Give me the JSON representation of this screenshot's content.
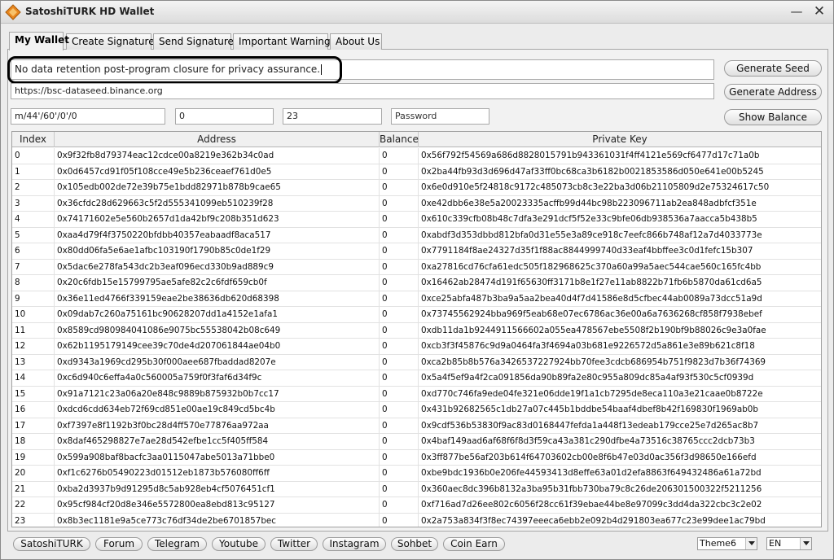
{
  "window": {
    "title": "SatoshiTURK HD Wallet",
    "minimize": "—",
    "close": "✕"
  },
  "tabs": [
    {
      "label": "My Wallet"
    },
    {
      "label": "Create Signature"
    },
    {
      "label": "Send Signature"
    },
    {
      "label": "Important Warning"
    },
    {
      "label": "About Us"
    }
  ],
  "form": {
    "message": "No data retention post-program closure for privacy assurance.",
    "rpc_url": "https://bsc-dataseed.binance.org",
    "derivation_path": "m/44'/60'/0'/0",
    "start_index": "0",
    "count": "23",
    "password_placeholder": "Password"
  },
  "buttons": {
    "generate_seed": "Generate Seed",
    "generate_address": "Generate Address",
    "show_balance": "Show Balance"
  },
  "table": {
    "headers": [
      "Index",
      "Address",
      "Balance",
      "Private Key"
    ],
    "rows": [
      [
        "0",
        "0x9f32fb8d79374eac12cdce00a8219e362b34c0ad",
        "0",
        "0x56f792f54569a686d8828015791b943361031f4ff4121e569cf6477d17c71a0b"
      ],
      [
        "1",
        "0x0d6457cd91f05f108cce49e5b236ceaef761d0e5",
        "0",
        "0x2ba44fb93d3d696d47af33ff0bc68ca3b6182b0021853586d050e641e00b5245"
      ],
      [
        "2",
        "0x105edb002de72e39b75e1bdd82971b878b9cae65",
        "0",
        "0x6e0d910e5f24818c9172c485073cb8c3e22ba3d06b21105809d2e75324617c50"
      ],
      [
        "3",
        "0x36cfdc28d629663c5f2d555341099eb510239f28",
        "0",
        "0xe42dbb6e38e5a20023335acffb99d44bc98b223096711ab2ea848adbfcf351e"
      ],
      [
        "4",
        "0x74171602e5e560b2657d1da42bf9c208b351d623",
        "0",
        "0x610c339cfb08b48c7dfa3e291dcf5f52e33c9bfe06db938536a7aacca5b438b5"
      ],
      [
        "5",
        "0xaa4d79f4f3750220bfdbb40357eabaadf8aca517",
        "0",
        "0xabdf3d353dbbd812bfa0d31e55e3a89ce918c7eefc866b748af12a7d4033773e"
      ],
      [
        "6",
        "0x80dd06fa5e6ae1afbc103190f1790b85c0de1f29",
        "0",
        "0x7791184f8ae24327d35f1f88ac8844999740d33eaf4bbffee3c0d1fefc15b307"
      ],
      [
        "7",
        "0x5dac6e278fa543dc2b3eaf096ecd330b9ad889c9",
        "0",
        "0xa27816cd76cfa61edc505f182968625c370a60a99a5aec544cae560c165fc4bb"
      ],
      [
        "8",
        "0x20c6fdb15e15799795ae5afe82c2c6fdf659cb0f",
        "0",
        "0x16462ab28474d191f65630ff3171b8e1f27e11ab8822b71fb6b5870da61cd6a5"
      ],
      [
        "9",
        "0x36e11ed4766f339159eae2be38636db620d68398",
        "0",
        "0xce25abfa487b3ba9a5aa2bea40d4f7d41586e8d5cfbec44ab0089a73dcc51a9d"
      ],
      [
        "10",
        "0x09dab7c260a75161bc90628207dd1a4152e1afa1",
        "0",
        "0x73745562924bba969f5eab68e07ec6786ac36e00a6a7636268cf858f7938ebef"
      ],
      [
        "11",
        "0x8589cd980984041086e9075bc55538042b08c649",
        "0",
        "0xdb11da1b9244911566602a055ea478567ebe5508f2b190bf9b88026c9e3a0fae"
      ],
      [
        "12",
        "0x62b1195179149cee39c70de4d207061844ae04b0",
        "0",
        "0xcb3f3f45876c9d9a0464fa3f4694a03b681e9226572d5a861e3e89b621c8f18"
      ],
      [
        "13",
        "0xd9343a1969cd295b30f000aee687fbaddad8207e",
        "0",
        "0xca2b85b8b576a3426537227924bb70fee3cdcb686954b751f9823d7b36f74369"
      ],
      [
        "14",
        "0xc6d940c6effa4a0c560005a759f0f3faf6d34f9c",
        "0",
        "0x5a4f5ef9a4f2ca091856da90b89fa2e80c955a809dc85a4af93f530c5cf0939d"
      ],
      [
        "15",
        "0x91a7121c23a06a20e848c9889b875932b0b7cc17",
        "0",
        "0xd770c746fa9ede04fe321e06dde19f1a1cb7295de8eca110a3e21caae0b8722e"
      ],
      [
        "16",
        "0xdcd6cdd634eb72f69cd851e00ae19c849cd5bc4b",
        "0",
        "0x431b92682565c1db27a07c445b1bddbe54baaf4dbef8b42f169830f1969ab0b"
      ],
      [
        "17",
        "0xf7397e8f1192b3f0bc28d4ff570e77876aa972aa",
        "0",
        "0x9cdf536b53830f9ac83d0168447fefda1a448f13edeab179cce25e7d265ac8b7"
      ],
      [
        "18",
        "0x8daf465298827e7ae28d542efbe1cc5f405ff584",
        "0",
        "0x4baf149aad6af68f6f8d3f59ca43a381c290dfbe4a73516c38765ccc2dcb73b3"
      ],
      [
        "19",
        "0x599a908baf8bacfc3aa0115047abe5013a71bbe0",
        "0",
        "0x3ff877be56af203b614f64703602cb00e8f6b47e03d0ac356f3d98650e166efd"
      ],
      [
        "20",
        "0xf1c6276b05490223d01512eb1873b576080ff6ff",
        "0",
        "0xbe9bdc1936b0e206fe44593413d8effe63a01d2efa8863f649432486a61a72bd"
      ],
      [
        "21",
        "0xba2d3937b9d91295d8c5ab928eb4cf5076451cf1",
        "0",
        "0x360aec8dc396b8132a3ba95b31fbb730ba79c8c26de206301500322f5211256"
      ],
      [
        "22",
        "0x95cf984cf20d8e346e5572800ea8ebd813c95127",
        "0",
        "0xf716ad7d26ee802c6056f28cc61f39ebae44be8e97099c3dd4da322cbc3c2e02"
      ],
      [
        "23",
        "0x8b3ec1181e9a5ce773c76df34de2be6701857bec",
        "0",
        "0x2a753a834f3f8ec74397eeeca6ebb2e092b4d291803ea677c23e99dee1ac79bd"
      ]
    ]
  },
  "footer": {
    "links": [
      "SatoshiTURK",
      "Forum",
      "Telegram",
      "Youtube",
      "Twitter",
      "Instagram",
      "Sohbet",
      "Coin Earn"
    ],
    "theme": "Theme6",
    "language": "EN"
  },
  "colors": {
    "highlight_ring": "#000000",
    "panel": "#f2f2f2",
    "logo_orange": "#e8861e"
  }
}
